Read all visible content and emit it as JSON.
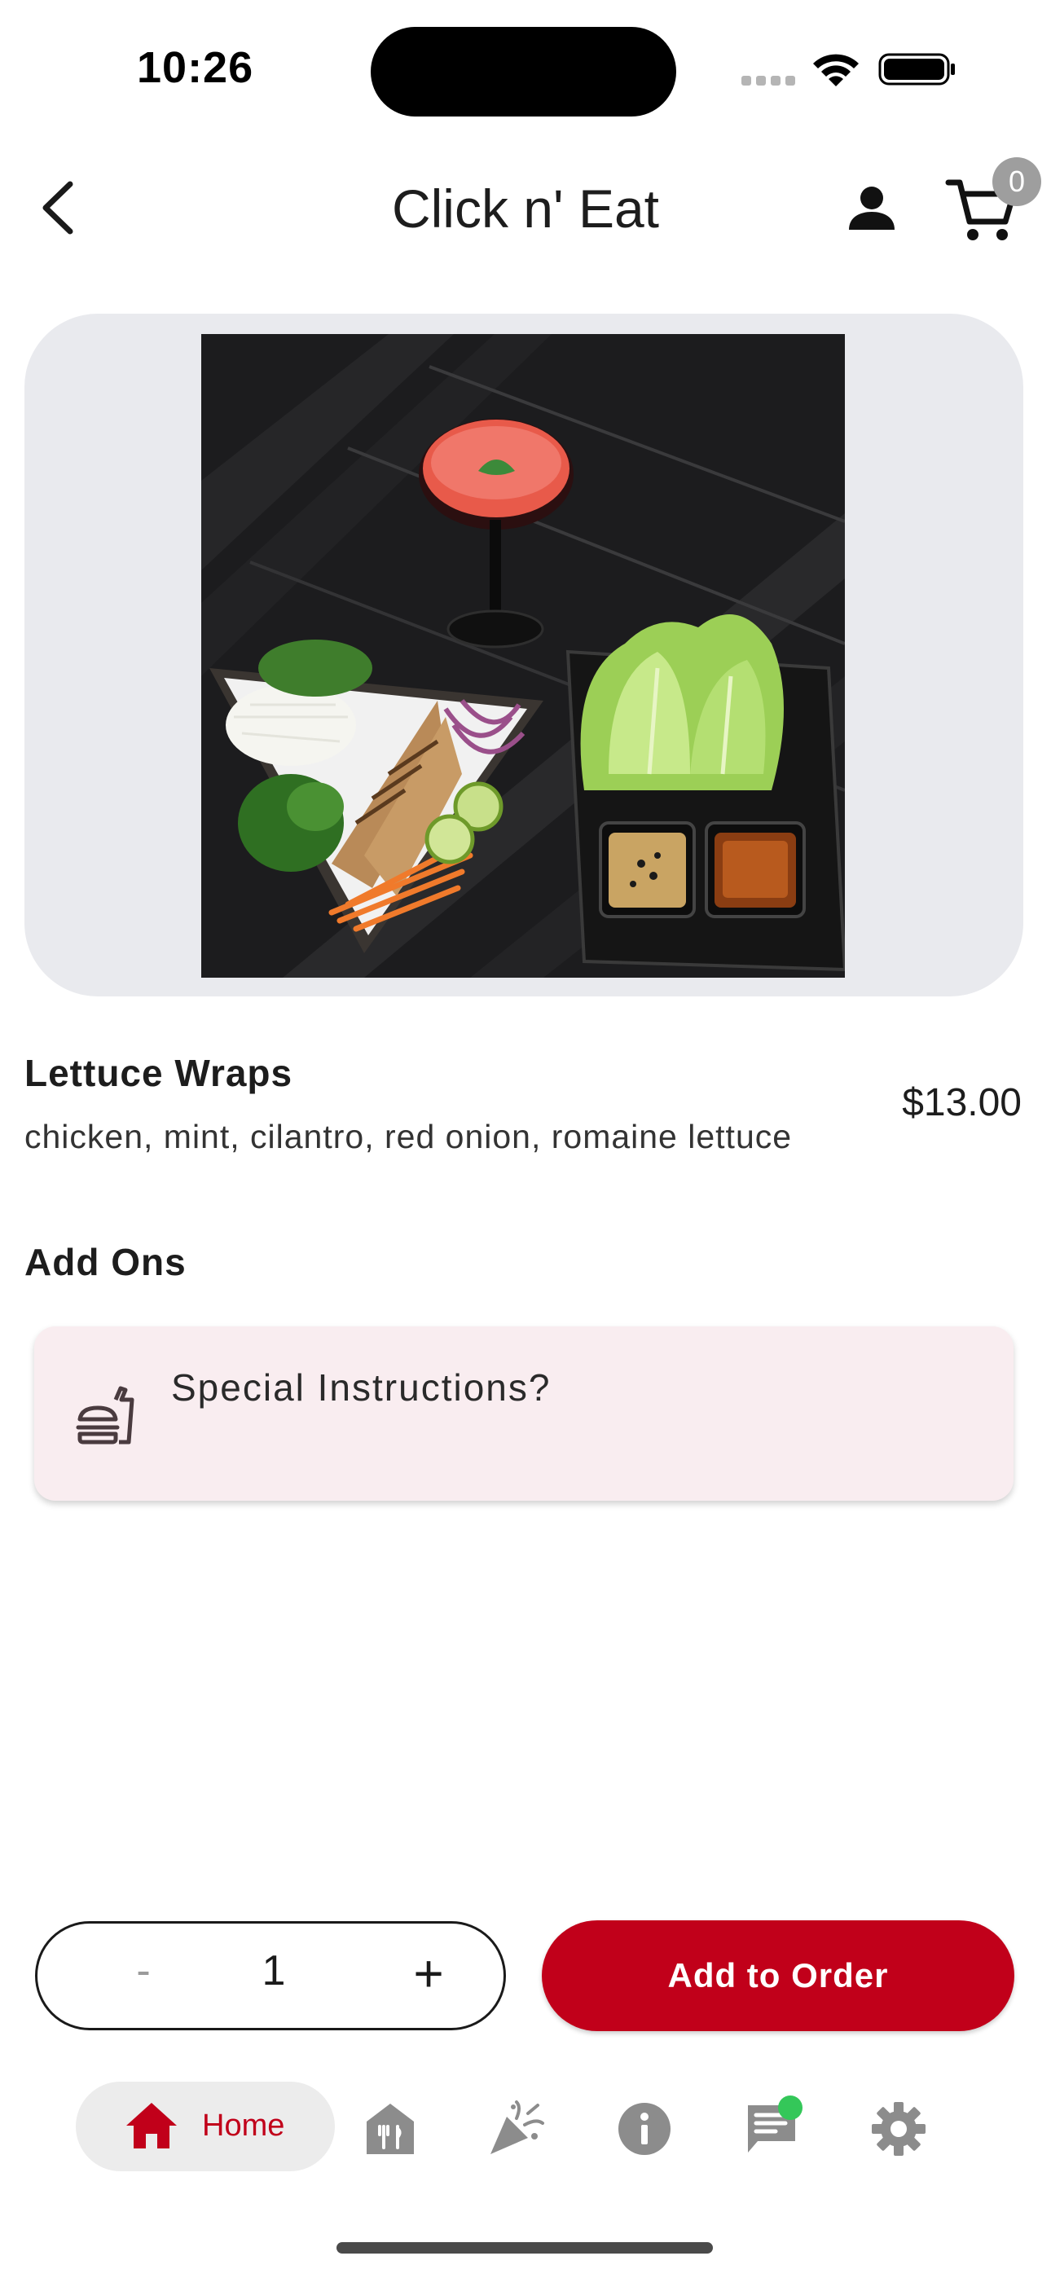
{
  "status_bar": {
    "time": "10:26"
  },
  "header": {
    "title": "Click n' Eat",
    "cart_count": "0"
  },
  "item": {
    "name": "Lettuce Wraps",
    "description": "chicken, mint, cilantro, red onion, romaine lettuce",
    "price": "$13.00"
  },
  "add_ons": {
    "title": "Add Ons",
    "special_instructions_label": "Special Instructions?"
  },
  "order": {
    "minus_label": "-",
    "quantity": "1",
    "plus_label": "+",
    "add_label": "Add to Order"
  },
  "nav": {
    "home_label": "Home",
    "items": [
      "home-icon",
      "restaurant-icon",
      "celebration-icon",
      "info-icon",
      "chat-icon",
      "settings-icon"
    ]
  },
  "colors": {
    "accent": "#c1001a",
    "hero_background": "#e9eaee",
    "card_background": "#f9edf0",
    "nav_icon": "#8c8c8c",
    "notification_dot": "#34c759"
  }
}
